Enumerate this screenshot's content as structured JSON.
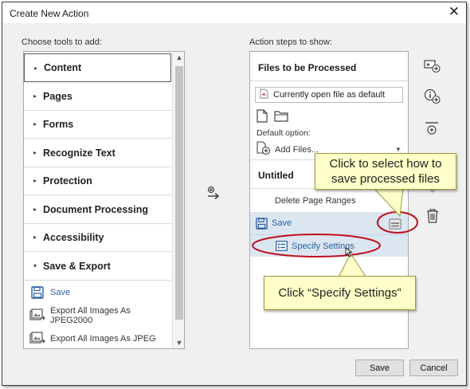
{
  "window": {
    "title": "Create New Action",
    "close_glyph": "✕"
  },
  "left": {
    "header": "Choose tools to add:",
    "categories": [
      {
        "label": "Content",
        "chevron": "▸",
        "selected": true
      },
      {
        "label": "Pages",
        "chevron": "▸"
      },
      {
        "label": "Forms",
        "chevron": "▸"
      },
      {
        "label": "Recognize Text",
        "chevron": "▸"
      },
      {
        "label": "Protection",
        "chevron": "▸"
      },
      {
        "label": "Document Processing",
        "chevron": "▸"
      },
      {
        "label": "Accessibility",
        "chevron": "▸"
      },
      {
        "label": "Save & Export",
        "chevron": "▾"
      }
    ],
    "tools": [
      {
        "label": "Save",
        "icon": "floppy-disk-icon"
      },
      {
        "label": "Export All Images As JPEG2000",
        "icon": "export-images-icon"
      },
      {
        "label": "Export All Images As JPEG",
        "icon": "export-images-icon"
      }
    ],
    "scroll_up": "▲",
    "scroll_down": "▼"
  },
  "right": {
    "header": "Action steps to show:",
    "files_title": "Files to be Processed",
    "default_file": "Currently open file as default",
    "default_option_label": "Default option:",
    "add_files": "Add Files...",
    "add_files_caret": "▼",
    "group_title": "Untitled",
    "steps": [
      {
        "label": "Delete Page Ranges"
      },
      {
        "label": "Save"
      },
      {
        "label": "Specify Settings"
      }
    ]
  },
  "side_buttons": [
    "add-instruction-step-icon",
    "add-instruction-info-icon",
    "add-divider-icon",
    "move-down-icon",
    "delete-trash-icon"
  ],
  "buttons": {
    "save": "Save",
    "cancel": "Cancel"
  },
  "callouts": {
    "select_line1": "Click to select  how to",
    "select_line2": "save processed files",
    "specify": "Click “Specify Settings”"
  },
  "colors": {
    "accent_blue": "#2a5f9e",
    "selected_row": "#dbe6f1",
    "callout_fill": "#fefec8",
    "annotation_red": "#c0111f"
  }
}
